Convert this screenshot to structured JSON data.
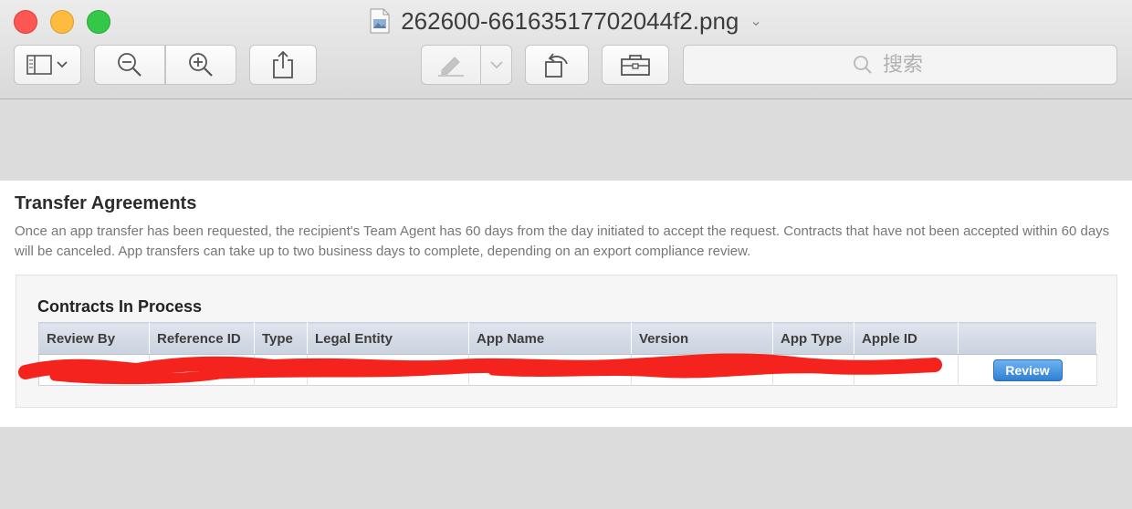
{
  "window": {
    "title": "262600-66163517702044f2.png",
    "traffic_colors": {
      "close": "#fc5753",
      "minimize": "#fdbc40",
      "maximize": "#34c748"
    }
  },
  "toolbar": {
    "buttons": [
      {
        "name": "sidebar-toggle",
        "icon": "sidebar-icon"
      },
      {
        "name": "zoom-out",
        "icon": "zoom-out-icon"
      },
      {
        "name": "zoom-in",
        "icon": "zoom-in-icon"
      },
      {
        "name": "share",
        "icon": "share-icon"
      },
      {
        "name": "markup",
        "icon": "pen-icon",
        "enabled": false
      },
      {
        "name": "rotate",
        "icon": "rotate-left-icon"
      },
      {
        "name": "toolbox",
        "icon": "toolbox-icon"
      }
    ],
    "search_placeholder": "搜索"
  },
  "page": {
    "title": "Transfer Agreements",
    "description": "Once an app transfer has been requested, the recipient's Team Agent has 60 days from the day initiated to accept the request. Contracts that have not been accepted within 60 days will be canceled. App transfers can take up to two business days to complete, depending on an export compliance review.",
    "contracts": {
      "heading": "Contracts In Process",
      "columns": [
        "Review By",
        "Reference ID",
        "Type",
        "Legal Entity",
        "App Name",
        "Version",
        "App Type",
        "Apple ID",
        ""
      ],
      "rows": [
        {
          "review_by": "",
          "reference_id": "",
          "type": "",
          "legal_entity": "",
          "app_name": "",
          "version": "",
          "app_type": "",
          "apple_id": "",
          "action": "Review"
        }
      ]
    },
    "redaction_color": "#f5231e"
  }
}
